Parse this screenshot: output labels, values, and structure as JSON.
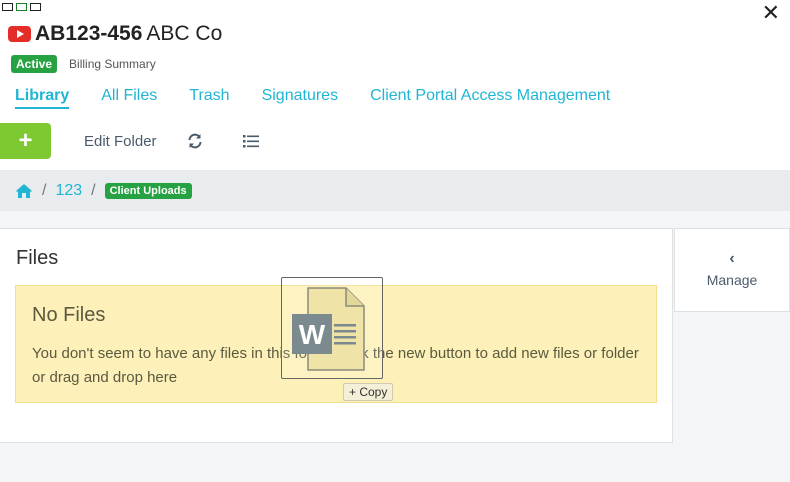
{
  "header": {
    "code": "AB123-456",
    "client_name": "ABC Co",
    "status_badge": "Active",
    "billing_link": "Billing Summary"
  },
  "tabs": [
    {
      "label": "Library",
      "active": true
    },
    {
      "label": "All Files",
      "active": false
    },
    {
      "label": "Trash",
      "active": false
    },
    {
      "label": "Signatures",
      "active": false
    },
    {
      "label": "Client Portal Access Management",
      "active": false
    }
  ],
  "toolbar": {
    "add_label": "+",
    "edit_folder_label": "Edit Folder",
    "refresh_icon": "refresh-icon",
    "list_icon": "list-icon"
  },
  "breadcrumb": {
    "home_icon": "home-icon",
    "separator": "/",
    "folder": "123",
    "current": "Client Uploads"
  },
  "files": {
    "title": "Files",
    "empty_title": "No Files",
    "empty_text": "You don't seem to have any files in this folder, click the new button to add new files or folder or drag and drop here"
  },
  "manage": {
    "chevron": "‹",
    "label": "Manage"
  },
  "drag": {
    "file_icon": "word-document-icon",
    "file_letter": "W",
    "copy_label": "+ Copy"
  },
  "close_label": "✕",
  "colors": {
    "accent_cyan": "#20b5d3",
    "green_badge": "#27a243",
    "add_button": "#7ec832",
    "empty_bg": "#fdf0b8"
  }
}
